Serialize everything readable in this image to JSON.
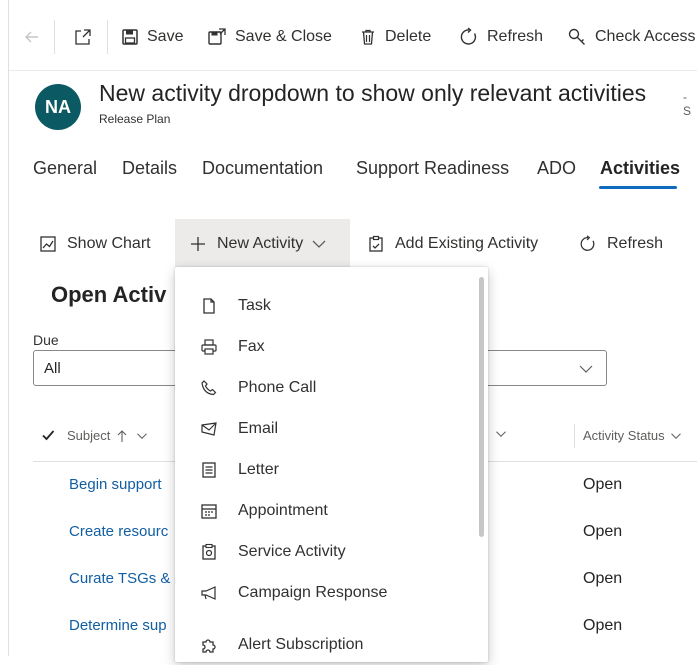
{
  "commandbar": {
    "save": "Save",
    "save_close": "Save & Close",
    "delete": "Delete",
    "refresh": "Refresh",
    "check_access": "Check Access"
  },
  "header": {
    "avatar_initials": "NA",
    "title": "New activity dropdown to show only relevant activities",
    "title_suffix": "- S",
    "entity": "Release Plan"
  },
  "tabs": [
    {
      "label": "General"
    },
    {
      "label": "Details"
    },
    {
      "label": "Documentation"
    },
    {
      "label": "Support Readiness"
    },
    {
      "label": "ADO"
    },
    {
      "label": "Activities",
      "active": true
    }
  ],
  "subgrid_toolbar": {
    "show_chart": "Show Chart",
    "new_activity": "New Activity",
    "add_existing": "Add Existing Activity",
    "refresh": "Refresh"
  },
  "section": {
    "title": "Open Activ",
    "due_label": "Due",
    "due_value": "All"
  },
  "grid": {
    "columns": {
      "subject": "Subject",
      "activity_status": "Activity Status"
    },
    "rows": [
      {
        "subject": "Begin support",
        "status": "Open"
      },
      {
        "subject": "Create resourc",
        "status": "Open"
      },
      {
        "subject": "Curate TSGs &",
        "status": "Open"
      },
      {
        "subject": "Determine sup",
        "status": "Open"
      }
    ]
  },
  "menu": {
    "items": [
      {
        "label": "Task",
        "icon": "task-icon"
      },
      {
        "label": "Fax",
        "icon": "fax-icon"
      },
      {
        "label": "Phone Call",
        "icon": "phone-icon"
      },
      {
        "label": "Email",
        "icon": "email-icon"
      },
      {
        "label": "Letter",
        "icon": "letter-icon"
      },
      {
        "label": "Appointment",
        "icon": "calendar-icon"
      },
      {
        "label": "Service Activity",
        "icon": "service-activity-icon"
      },
      {
        "label": "Campaign Response",
        "icon": "megaphone-icon"
      },
      {
        "label": "Alert Subscription",
        "icon": "puzzle-icon"
      }
    ]
  },
  "colors": {
    "accent": "#0f6cbd",
    "avatar_bg": "#0b5a63",
    "link": "#115ea3"
  }
}
